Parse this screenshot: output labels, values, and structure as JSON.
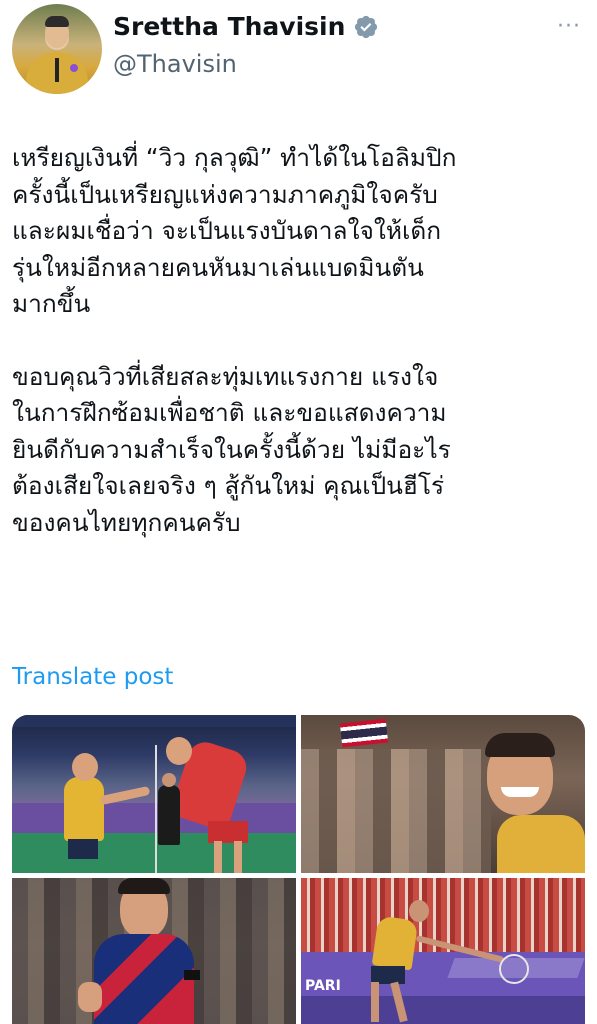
{
  "author": {
    "name": "Srettha Thavisin",
    "handle": "@Thavisin",
    "avatar_icon": "profile-photo",
    "verified_icon": "verified-badge-icon",
    "verified_color": "#829aab"
  },
  "more_label": "···",
  "post": {
    "paragraphs": [
      {
        "lines": [
          "เหรียญเงินที่ “วิว กุลวุฒิ” ทำได้ในโอลิมปิก",
          "ครั้งนี้เป็นเหรียญแห่งความภาคภูมิใจครับ",
          "และผมเชื่อว่า จะเป็นแรงบันดาลใจให้เด็ก",
          "รุ่นใหม่อีกหลายคนหันมาเล่นแบดมินตัน",
          "มากขึ้น"
        ]
      },
      {
        "lines": [
          "ขอบคุณวิวที่เสียสละทุ่มเทแรงกาย แรงใจ",
          "ในการฝึกซ้อมเพื่อชาติ และขอแสดงความ",
          "ยินดีกับความสำเร็จในครั้งนี้ด้วย ไม่มีอะไร",
          "ต้องเสียใจเลยจริง ๆ สู้กันใหม่ คุณเป็นฮีโร่",
          "ของคนไทยทุกคนครับ"
        ]
      }
    ]
  },
  "translate_label": "Translate post",
  "link_color": "#1d9bf0",
  "media": {
    "photos": [
      {
        "name": "photo-badminton-handshake"
      },
      {
        "name": "photo-athlete-smiling-crowd"
      },
      {
        "name": "photo-athlete-thumbs-up"
      },
      {
        "name": "photo-athlete-playing-court"
      }
    ],
    "court_banner_text": "PARI"
  }
}
